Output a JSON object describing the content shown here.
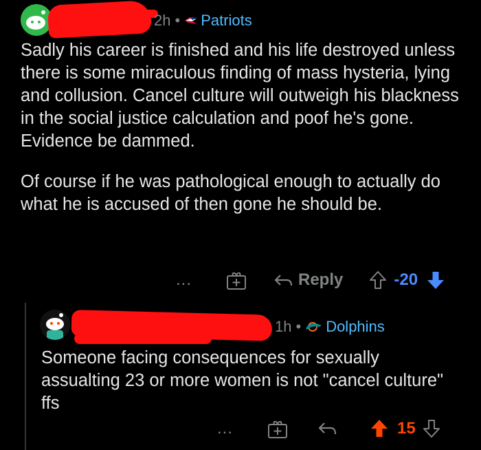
{
  "comment1": {
    "time": "2h",
    "flair_label": "Patriots",
    "paragraphs": [
      "Sadly his career is finished and his life destroyed unless there is some miraculous finding of mass hysteria, lying and collusion. Cancel culture will outweigh his blackness in the social justice calculation and poof he's gone. Evidence be dammed.",
      "Of course if he was pathological enough to actually do what he is accused of then gone he should be."
    ],
    "actions": {
      "more": "...",
      "reply_label": "Reply",
      "score": "-20"
    }
  },
  "comment2": {
    "time": "1h",
    "flair_label": "Dolphins",
    "body": "Someone facing consequences for sexually assualting 23 or more women is not \"cancel culture\" ffs",
    "actions": {
      "more": "...",
      "score": "15"
    }
  },
  "colors": {
    "background": "#000000",
    "text": "#e6e6e6",
    "muted": "#818384",
    "flair": "#4fbcff",
    "downvote": "#4a8cff",
    "upvote": "#ff4500",
    "redaction": "#ff1010"
  }
}
